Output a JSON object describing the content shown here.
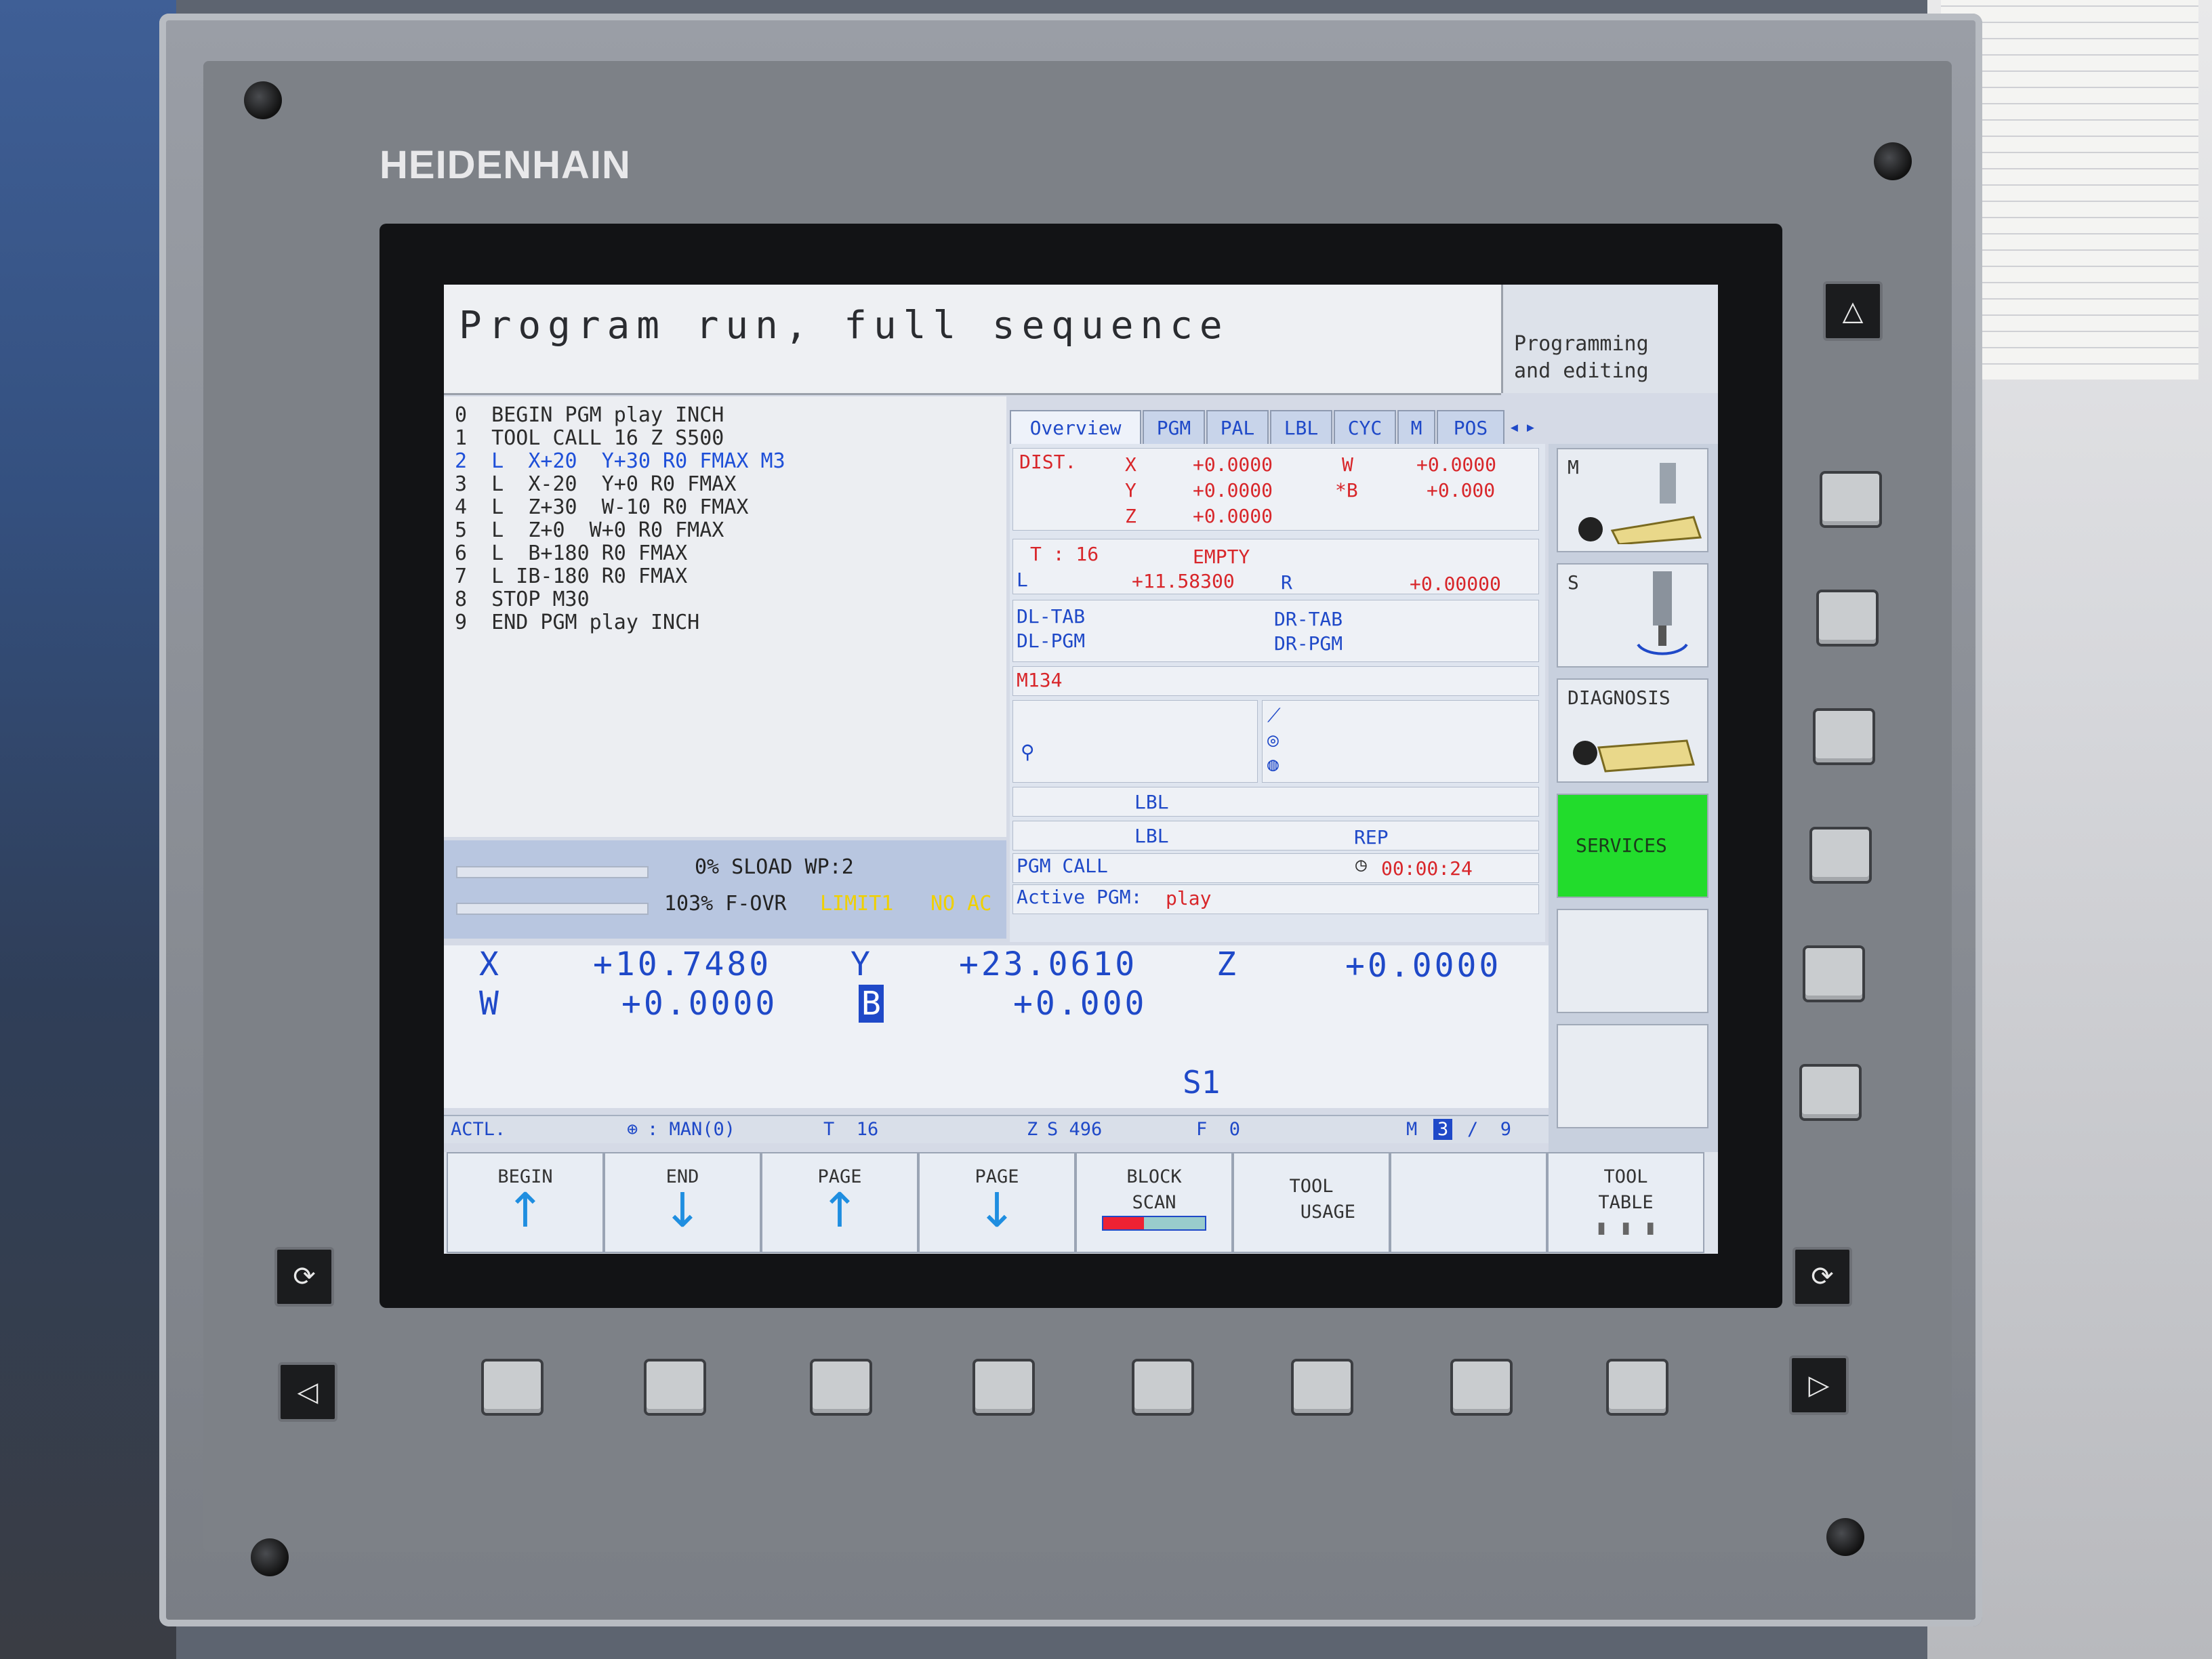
{
  "brand": "HEIDENHAIN",
  "header": {
    "title": "Program run, full sequence",
    "mode_line1": "Programming",
    "mode_line2": "and editing"
  },
  "program": {
    "lines": [
      "0  BEGIN PGM play INCH",
      "1  TOOL CALL 16 Z S500",
      "2  L  X+20  Y+30 R0 FMAX M3",
      "3  L  X-20  Y+0 R0 FMAX",
      "4  L  Z+30  W-10 R0 FMAX",
      "5  L  Z+0  W+0 R0 FMAX",
      "6  L  B+180 R0 FMAX",
      "7  L IB-180 R0 FMAX",
      "8  STOP M30",
      "9  END PGM play INCH"
    ],
    "active_line": 2
  },
  "status": {
    "sload": "0% SLOAD WP:2",
    "fovr": "103% F-OVR",
    "limit": "LIMIT1",
    "noac": "NO AC"
  },
  "tabs": [
    "Overview",
    "PGM",
    "PAL",
    "LBL",
    "CYC",
    "M",
    "POS"
  ],
  "overview": {
    "dist_label": "DIST.",
    "dist": [
      {
        "axis": "X",
        "value": "+0.0000"
      },
      {
        "axis": "Y",
        "value": "+0.0000"
      },
      {
        "axis": "Z",
        "value": "+0.0000"
      },
      {
        "axis": "W",
        "value": "+0.0000"
      },
      {
        "axis": "*B",
        "value": "+0.000"
      }
    ],
    "tool_label": "T : 16",
    "tool_status": "EMPTY",
    "l_label": "L",
    "l_value": "+11.58300",
    "r_label": "R",
    "r_value": "+0.00000",
    "dl_tab": "DL-TAB",
    "dl_pgm": "DL-PGM",
    "dr_tab": "DR-TAB",
    "dr_pgm": "DR-PGM",
    "m134": "M134",
    "lbl1": "LBL",
    "lbl2": "LBL",
    "rep": "REP",
    "pgm_call": "PGM CALL",
    "time": "00:00:24",
    "active_pgm_label": "Active PGM:",
    "active_pgm": "play"
  },
  "side": {
    "m": "M",
    "s": "S",
    "diagnosis": "DIAGNOSIS",
    "services": "SERVICES"
  },
  "axes": {
    "x_label": "X",
    "x_value": "+10.7480",
    "y_label": "Y",
    "y_value": "+23.0610",
    "z_label": "Z",
    "z_value": "+0.0000",
    "w_label": "W",
    "w_value": "+0.0000",
    "b_label": "B",
    "b_value": "+0.000",
    "s1": "S1"
  },
  "infobar": {
    "actl": "ACTL.",
    "man": ": MAN(0)",
    "t": "T  16",
    "z": "Z",
    "s": "S 496",
    "f": "F  0",
    "m": "M",
    "m_val": "3",
    "m_rest": "/  9"
  },
  "softkeys": {
    "begin": "BEGIN",
    "end": "END",
    "page_up": "PAGE",
    "page_down": "PAGE",
    "block_scan": "BLOCK\nSCAN",
    "tool_usage": "TOOL\n   USAGE",
    "tool_table": "TOOL\nTABLE"
  },
  "colors": {
    "accent_blue": "#1f49c8",
    "alert_red": "#d8262a",
    "services_green": "#22dc2c",
    "limit_yellow": "#f0d000"
  }
}
